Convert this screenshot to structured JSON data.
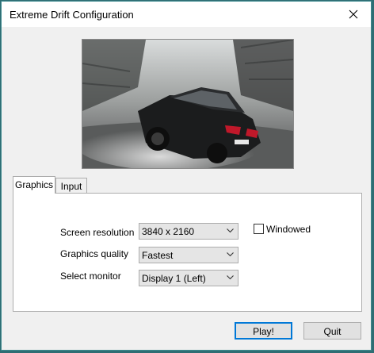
{
  "window": {
    "title": "Extreme Drift Configuration"
  },
  "banner": {
    "image": "drifting-car-photo"
  },
  "tabs": [
    {
      "label": "Graphics",
      "active": true
    },
    {
      "label": "Input",
      "active": false
    }
  ],
  "graphics": {
    "screen_resolution": {
      "label": "Screen resolution",
      "value": "3840 x 2160"
    },
    "graphics_quality": {
      "label": "Graphics quality",
      "value": "Fastest"
    },
    "select_monitor": {
      "label": "Select monitor",
      "value": "Display 1 (Left)"
    },
    "windowed": {
      "label": "Windowed",
      "checked": false
    }
  },
  "buttons": {
    "play": "Play!",
    "quit": "Quit"
  },
  "icons": {
    "close": "close-icon",
    "dropdown": "chevron-down-icon"
  },
  "colors": {
    "accent": "#0078d7",
    "border": "#adadad"
  }
}
